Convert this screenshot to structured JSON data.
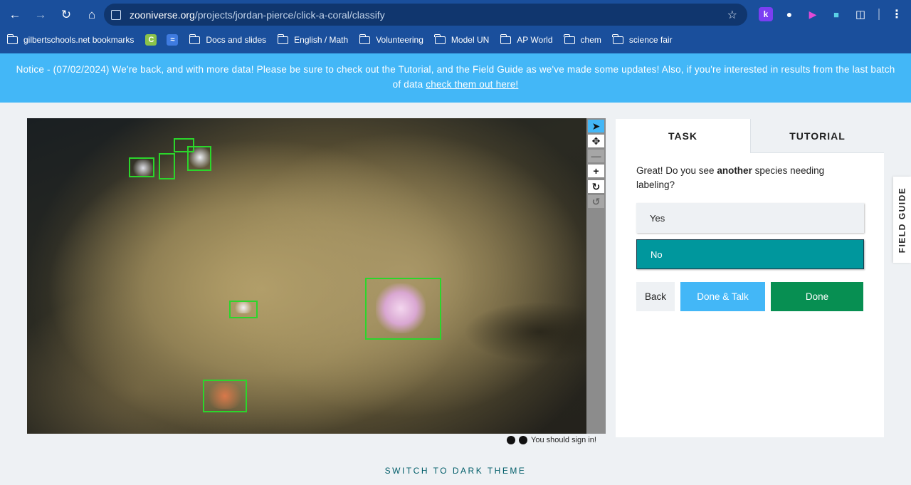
{
  "browser": {
    "url_host": "zooniverse.org",
    "url_path": "/projects/jordan-pierce/click-a-coral/classify",
    "icons": [
      "back-icon",
      "forward-icon",
      "reload-icon",
      "home-icon",
      "site-info-icon",
      "star-icon",
      "extensions-icon",
      "menu-icon"
    ],
    "extension_labels": [
      "k"
    ],
    "bookmarks": [
      {
        "label": "gilbertschools.net bookmarks",
        "icon": "managed-folder-icon"
      },
      {
        "label": "",
        "icon": "c-favicon"
      },
      {
        "label": "",
        "icon": "site-favicon"
      },
      {
        "label": "Docs and slides",
        "icon": "folder-icon"
      },
      {
        "label": "English / Math",
        "icon": "folder-icon"
      },
      {
        "label": "Volunteering",
        "icon": "folder-icon"
      },
      {
        "label": "Model UN",
        "icon": "folder-icon"
      },
      {
        "label": "AP World",
        "icon": "folder-icon"
      },
      {
        "label": "chem",
        "icon": "folder-icon"
      },
      {
        "label": "science fair",
        "icon": "folder-icon"
      }
    ],
    "c_favicon_letter": "C"
  },
  "notice": {
    "text": "Notice - (07/02/2024) We're back, and with more data! Please be sure to check out the Tutorial, and the Field Guide as we've made some updates! Also, if you're interested in results from the last batch of data ",
    "link": "check them out here!"
  },
  "viewer": {
    "tools": [
      "pointer-icon",
      "move-icon",
      "zoom-out-icon",
      "zoom-in-icon",
      "rotate-icon",
      "reset-icon"
    ],
    "annotation_count": 7,
    "footer_icons": [
      "invert-icon",
      "info-icon"
    ],
    "footer_text": "You should sign in!"
  },
  "task_panel": {
    "tabs": [
      "TASK",
      "TUTORIAL"
    ],
    "question_pre": "Great! Do you see ",
    "question_bold": "another",
    "question_post": " species needing labeling?",
    "answers": [
      "Yes",
      "No"
    ],
    "selected_answer": "No",
    "buttons": {
      "back": "Back",
      "done_talk": "Done & Talk",
      "done": "Done"
    }
  },
  "field_guide": "FIELD GUIDE",
  "theme_toggle": "SWITCH TO DARK THEME",
  "colors": {
    "chrome": "#1a4f9c",
    "notice_bg": "#43b7f7",
    "selected_answer": "#00979d",
    "done_button": "#078f52",
    "annotation_box": "#2bd62b"
  }
}
